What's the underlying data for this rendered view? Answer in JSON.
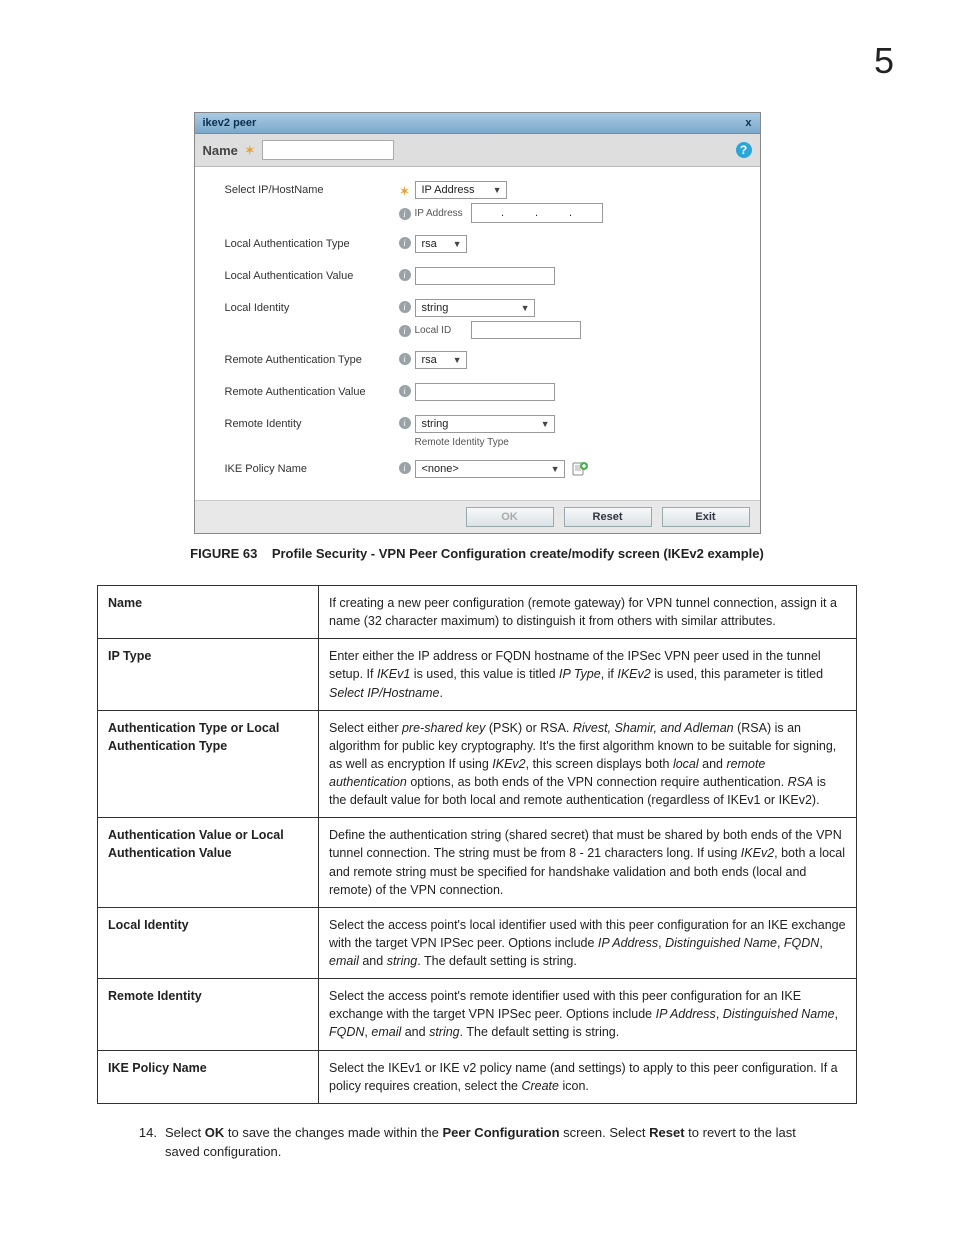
{
  "pageNumber": "5",
  "dialog": {
    "title": "ikev2 peer",
    "nameLabel": "Name",
    "helpGlyph": "?",
    "closeGlyph": "x",
    "fields": {
      "selectIpHost": {
        "label": "Select IP/HostName",
        "value": "IP Address"
      },
      "ipAddress": {
        "sublabel": "IP Address"
      },
      "localAuthType": {
        "label": "Local Authentication Type",
        "value": "rsa"
      },
      "localAuthValue": {
        "label": "Local Authentication Value"
      },
      "localIdentity": {
        "label": "Local Identity",
        "value": "string",
        "sublabel": "Local ID"
      },
      "remoteAuthType": {
        "label": "Remote Authentication Type",
        "value": "rsa"
      },
      "remoteAuthValue": {
        "label": "Remote Authentication Value"
      },
      "remoteIdentity": {
        "label": "Remote Identity",
        "value": "string",
        "sublabel": "Remote Identity Type"
      },
      "ikePolicy": {
        "label": "IKE Policy Name",
        "value": "<none>"
      }
    },
    "buttons": {
      "ok": "OK",
      "reset": "Reset",
      "exit": "Exit"
    }
  },
  "figure": {
    "number": "FIGURE 63",
    "caption": "Profile Security - VPN Peer Configuration create/modify screen (IKEv2 example)"
  },
  "defs": [
    {
      "term": "Name",
      "desc": "If creating a new peer configuration (remote gateway) for VPN tunnel connection, assign it a name (32 character maximum) to distinguish it from others with similar attributes."
    },
    {
      "term": "IP Type",
      "desc": "Enter either the IP address or FQDN hostname of the IPSec VPN peer used in the tunnel setup. If <em>IKEv1</em> is used, this value is titled <em>IP Type</em>, if <em>IKEv2</em> is used, this parameter is titled <em>Select IP/Hostname</em>."
    },
    {
      "term": "Authentication Type or Local Authentication Type",
      "desc": "Select either <em>pre-shared key</em> (PSK) or RSA. <em>Rivest, Shamir, and Adleman</em> (RSA) is an algorithm for public key cryptography. It's the first algorithm known to be suitable for signing, as well as encryption If using <em>IKEv2</em>, this screen displays both <em>local</em> and <em>remote authentication</em> options, as both ends of the VPN connection require authentication. <em>RSA</em> is the default value for both local and remote authentication (regardless of IKEv1 or IKEv2)."
    },
    {
      "term": "Authentication Value or Local Authentication Value",
      "desc": "Define the authentication string (shared secret) that must be shared by both ends of the VPN tunnel connection. The string must be from 8 - 21 characters long. If using <em>IKEv2</em>, both a local and remote string must be specified for handshake validation and both ends (local and remote) of the VPN connection."
    },
    {
      "term": "Local Identity",
      "desc": "Select the access point's local identifier used with this peer configuration for an IKE exchange with the target VPN IPSec peer. Options include <em>IP Address</em>, <em>Distinguished Name</em>, <em>FQDN</em>, <em>email</em> and <em>string</em>. The default setting is string."
    },
    {
      "term": "Remote Identity",
      "desc": "Select the access point's remote identifier used with this peer configuration for an IKE exchange with the target VPN IPSec peer. Options include <em>IP Address</em>, <em>Distinguished Name</em>, <em>FQDN</em>, <em>email</em> and <em>string</em>. The default setting is string."
    },
    {
      "term": "IKE Policy Name",
      "desc": "Select the IKEv1 or IKE v2 policy name (and settings) to apply to this peer configuration. If a policy requires creation, select the <em>Create</em> icon."
    }
  ],
  "step": {
    "number": "14.",
    "text": "Select <b>OK</b> to save the changes made within the <b>Peer Configuration</b> screen. Select <b>Reset</b> to revert to the last saved configuration."
  }
}
